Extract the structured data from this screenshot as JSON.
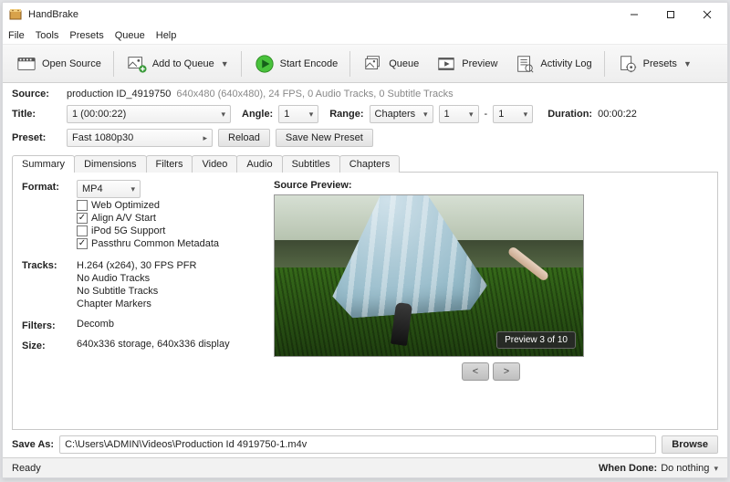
{
  "window": {
    "title": "HandBrake"
  },
  "menubar": [
    "File",
    "Tools",
    "Presets",
    "Queue",
    "Help"
  ],
  "toolbar": {
    "open_source": "Open Source",
    "add_to_queue": "Add to Queue",
    "start_encode": "Start Encode",
    "queue": "Queue",
    "preview": "Preview",
    "activity_log": "Activity Log",
    "presets": "Presets"
  },
  "source": {
    "label": "Source:",
    "name": "production ID_4919750",
    "info": "640x480 (640x480), 24 FPS, 0 Audio Tracks, 0 Subtitle Tracks"
  },
  "title_row": {
    "title_label": "Title:",
    "title_value": "1  (00:00:22)",
    "angle_label": "Angle:",
    "angle_value": "1",
    "range_label": "Range:",
    "range_mode": "Chapters",
    "range_from": "1",
    "range_sep": "-",
    "range_to": "1",
    "duration_label": "Duration:",
    "duration_value": "00:00:22"
  },
  "preset_row": {
    "label": "Preset:",
    "value": "Fast 1080p30",
    "reload": "Reload",
    "save_new": "Save New Preset"
  },
  "tabs": [
    "Summary",
    "Dimensions",
    "Filters",
    "Video",
    "Audio",
    "Subtitles",
    "Chapters"
  ],
  "summary": {
    "format_label": "Format:",
    "format_value": "MP4",
    "opt_web": "Web Optimized",
    "opt_align": "Align A/V Start",
    "opt_ipod": "iPod 5G Support",
    "opt_passthru": "Passthru Common Metadata",
    "tracks_label": "Tracks:",
    "tracks": [
      "H.264 (x264), 30 FPS PFR",
      "No Audio Tracks",
      "No Subtitle Tracks",
      "Chapter Markers"
    ],
    "filters_label": "Filters:",
    "filters_value": "Decomb",
    "size_label": "Size:",
    "size_value": "640x336 storage, 640x336 display",
    "preview_label": "Source Preview:",
    "preview_badge": "Preview 3 of 10",
    "nav_prev": "<",
    "nav_next": ">"
  },
  "saveas": {
    "label": "Save As:",
    "path": "C:\\Users\\ADMIN\\Videos\\Production Id 4919750-1.m4v",
    "browse": "Browse"
  },
  "status": {
    "ready": "Ready",
    "when_done_label": "When Done:",
    "when_done_value": "Do nothing"
  }
}
